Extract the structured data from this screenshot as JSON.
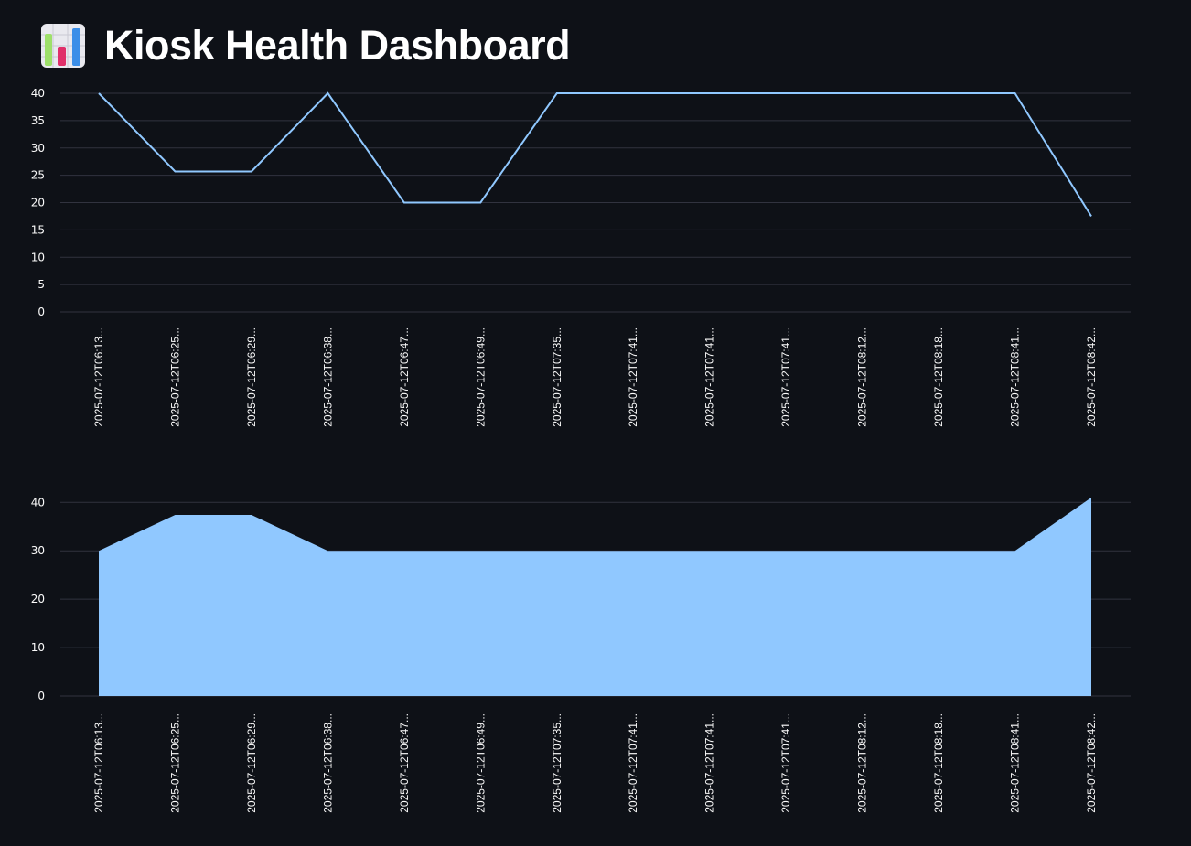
{
  "header": {
    "title": "Kiosk Health Dashboard",
    "icon": "bar-chart-icon"
  },
  "colors": {
    "background": "#0e1117",
    "series": "#90c8ff",
    "grid": "#31333f",
    "text": "#fafafa"
  },
  "chart_data": [
    {
      "type": "line",
      "categories": [
        "2025-07-12T06:13...",
        "2025-07-12T06:25...",
        "2025-07-12T06:29...",
        "2025-07-12T06:38...",
        "2025-07-12T06:47...",
        "2025-07-12T06:49...",
        "2025-07-12T07:35...",
        "2025-07-12T07:41...",
        "2025-07-12T07:41...",
        "2025-07-12T07:41...",
        "2025-07-12T08:12...",
        "2025-07-12T08:18...",
        "2025-07-12T08:41...",
        "2025-07-12T08:42..."
      ],
      "values": [
        40,
        25.7,
        25.7,
        40,
        20,
        20,
        40,
        40,
        40,
        40,
        40,
        40,
        40,
        17.5
      ],
      "yticks": [
        0,
        5,
        10,
        15,
        20,
        25,
        30,
        35,
        40
      ],
      "ylim": [
        0,
        40
      ],
      "grid": true,
      "legend": "none"
    },
    {
      "type": "area",
      "categories": [
        "2025-07-12T06:13...",
        "2025-07-12T06:25...",
        "2025-07-12T06:29...",
        "2025-07-12T06:38...",
        "2025-07-12T06:47...",
        "2025-07-12T06:49...",
        "2025-07-12T07:35...",
        "2025-07-12T07:41...",
        "2025-07-12T07:41...",
        "2025-07-12T07:41...",
        "2025-07-12T08:12...",
        "2025-07-12T08:18...",
        "2025-07-12T08:41...",
        "2025-07-12T08:42..."
      ],
      "values": [
        30,
        37.4,
        37.4,
        30,
        30,
        30,
        30,
        30,
        30,
        30,
        30,
        30,
        30,
        41
      ],
      "yticks": [
        0,
        10,
        20,
        30,
        40
      ],
      "ylim": [
        0,
        41
      ],
      "grid": true,
      "legend": "none"
    }
  ]
}
